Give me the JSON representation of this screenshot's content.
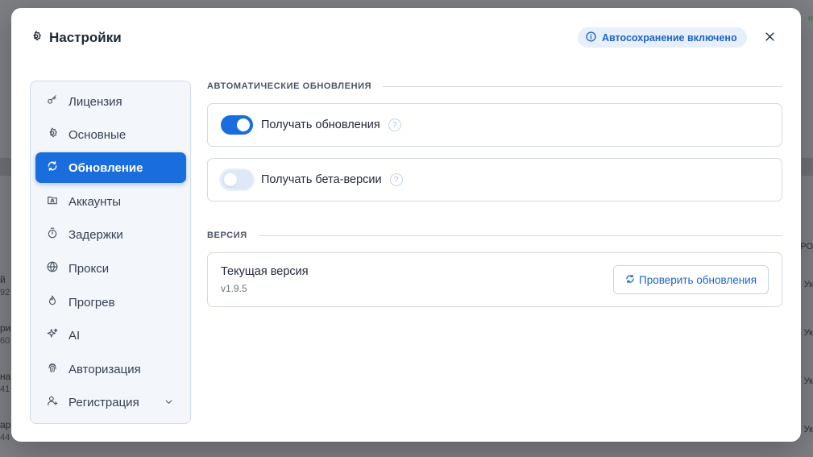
{
  "background": {
    "left_fragments": [
      "й",
      "92",
      "ри",
      "60",
      "на",
      "41",
      "ар",
      "44"
    ],
    "right_fragments": [
      "н",
      "РО",
      "Ук",
      "Ук",
      "Ук",
      "Ук"
    ]
  },
  "modal": {
    "title": "Настройки",
    "title_icon": "gear-icon",
    "autosave_badge": "Автосохранение включено",
    "close_icon": "close-icon"
  },
  "sidebar": {
    "items": [
      {
        "label": "Лицензия",
        "icon": "key-icon",
        "active": false
      },
      {
        "label": "Основные",
        "icon": "gear-icon",
        "active": false
      },
      {
        "label": "Обновление",
        "icon": "refresh-icon",
        "active": true
      },
      {
        "label": "Аккаунты",
        "icon": "account-folder-icon",
        "active": false
      },
      {
        "label": "Задержки",
        "icon": "timer-icon",
        "active": false
      },
      {
        "label": "Прокси",
        "icon": "globe-icon",
        "active": false
      },
      {
        "label": "Прогрев",
        "icon": "flame-icon",
        "active": false
      },
      {
        "label": "AI",
        "icon": "sparkles-icon",
        "active": false
      },
      {
        "label": "Авторизация",
        "icon": "fingerprint-icon",
        "active": false
      },
      {
        "label": "Регистрация",
        "icon": "user-plus-icon",
        "active": false,
        "expandable": true
      }
    ]
  },
  "updates": {
    "section_title": "АВТОМАТИЧЕСКИЕ ОБНОВЛЕНИЯ",
    "receive_updates": {
      "label": "Получать обновления",
      "enabled": true
    },
    "receive_beta": {
      "label": "Получать бета-версии",
      "enabled": false
    },
    "help_symbol": "?"
  },
  "version": {
    "section_title": "ВЕРСИЯ",
    "current_label": "Текущая версия",
    "current_value": "v1.9.5",
    "check_button": "Проверить обновления"
  },
  "colors": {
    "accent": "#1a6ddc",
    "badge_bg": "#e6effa",
    "sidebar_bg": "#f3f6fb"
  }
}
